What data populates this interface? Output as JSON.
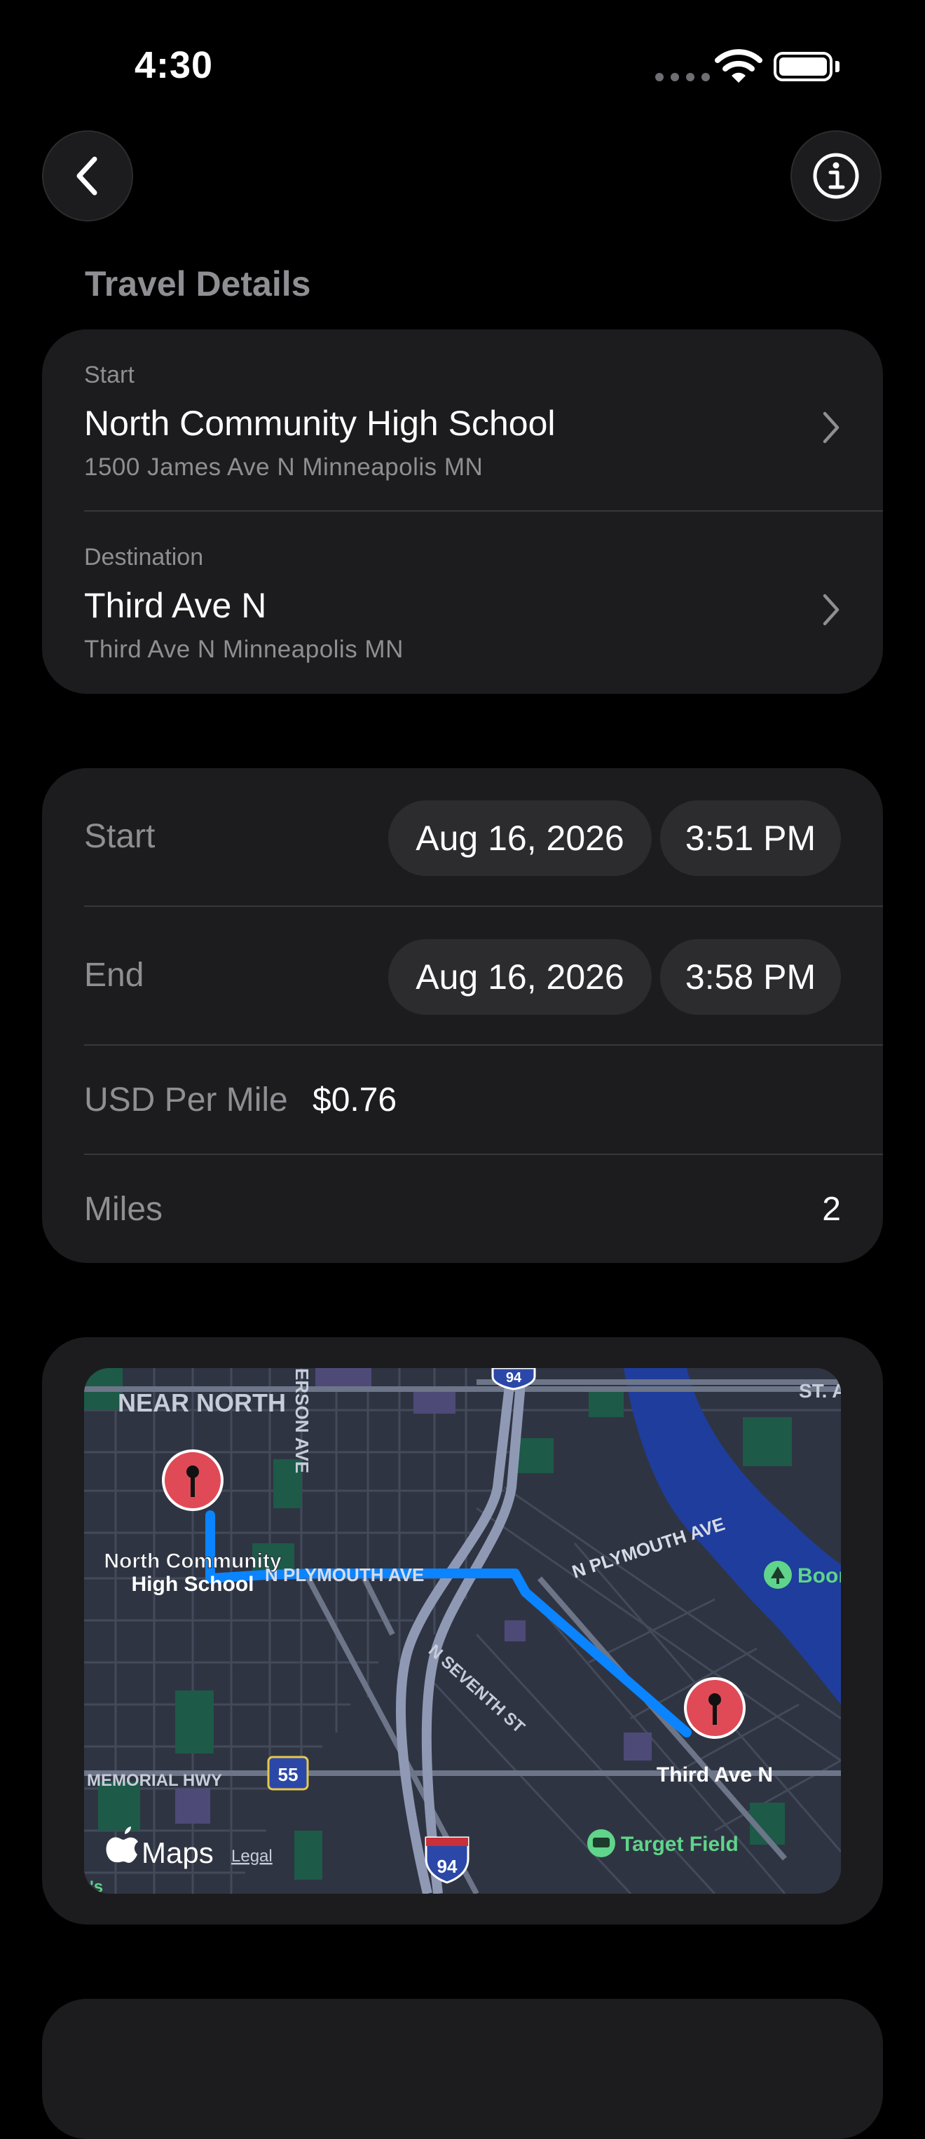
{
  "status_bar": {
    "time": "4:30"
  },
  "header": {
    "section_title": "Travel Details"
  },
  "locations": {
    "start": {
      "label": "Start",
      "name": "North Community High School",
      "address": "1500 James Ave N Minneapolis MN"
    },
    "destination": {
      "label": "Destination",
      "name": "Third Ave N",
      "address": "Third Ave N Minneapolis MN"
    }
  },
  "trip": {
    "start": {
      "label": "Start",
      "date": "Aug 16, 2026",
      "time": "3:51 PM"
    },
    "end": {
      "label": "End",
      "date": "Aug 16, 2026",
      "time": "3:58 PM"
    },
    "rate": {
      "label": "USD Per Mile",
      "value": "$0.76"
    },
    "miles": {
      "label": "Miles",
      "value": "2"
    }
  },
  "map": {
    "neighborhood": "NEAR NORTH",
    "street_vertical": "ERSON AVE",
    "street_plymouth_west": "N PLYMOUTH AVE",
    "street_plymouth_east": "N PLYMOUTH AVE",
    "street_seventh": "N SEVENTH ST",
    "street_memorial": "MEMORIAL HWY",
    "street_st": "ST. A",
    "highway_55": "55",
    "highway_94_top": "94",
    "highway_94_bottom": "94",
    "start_pin_label_line1": "North Community",
    "start_pin_label_line2": "High School",
    "end_pin_label": "Third Ave N",
    "poi_boom": "Boon",
    "poi_target_field": "Target Field",
    "attribution": "Maps",
    "legal": "Legal",
    "edge_fragment": "t's",
    "colors": {
      "route": "#0a84ff",
      "water": "#1f3d9c",
      "park": "#1d5a48",
      "pin": "#e04a57",
      "poi_green": "#5fd48a"
    }
  }
}
